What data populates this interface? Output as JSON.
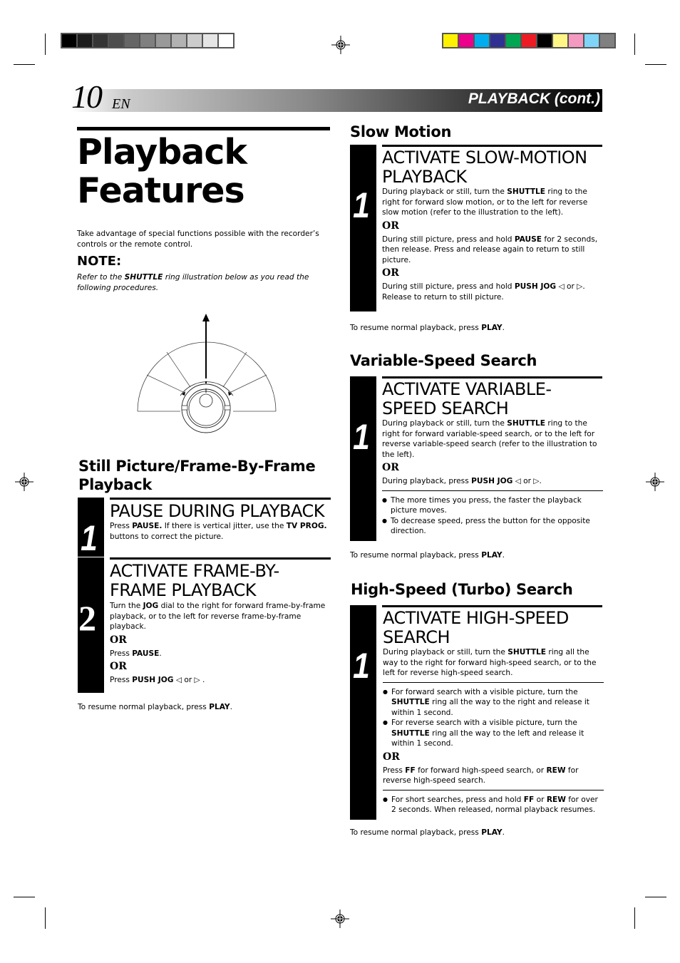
{
  "print_marks": {
    "grayscale_bar": [
      "#000000",
      "#1c1c1c",
      "#353535",
      "#4d4d4d",
      "#666666",
      "#7f7f7f",
      "#999999",
      "#b2b2b2",
      "#cccccc",
      "#e5e5e5",
      "#ffffff"
    ],
    "color_bar": [
      "#fff200",
      "#ec008c",
      "#00aeef",
      "#2e3192",
      "#00a651",
      "#ed1c24",
      "#000000",
      "#fff685",
      "#f49ac1",
      "#7fd4f7",
      "#808080"
    ]
  },
  "header": {
    "page_number": "10",
    "lang": "EN",
    "section_title": "PLAYBACK (cont.)"
  },
  "left": {
    "title_line1": "Playback",
    "title_line2": "Features",
    "intro": "Take advantage of special functions possible with the recorder’s controls or the remote control.",
    "note_heading": "NOTE:",
    "note_pre": "Refer to the ",
    "note_bold": "SHUTTLE",
    "note_post": " ring illustration below as you read the following procedures.",
    "still_heading": "Still Picture/Frame-By-Frame Playback",
    "step1": {
      "number": "1",
      "title": "PAUSE DURING PLAYBACK",
      "t1": "Press ",
      "b1": "PAUSE.",
      "t2": " If there is vertical jitter, use the ",
      "b2": "TV PROG.",
      "t3": " buttons to correct the picture."
    },
    "step2": {
      "number": "2",
      "title": "ACTIVATE FRAME-BY-FRAME PLAYBACK",
      "t1": "Turn the ",
      "b1": "JOG",
      "t2": " dial to the right for forward frame-by-frame playback, or to the left for reverse frame-by-frame playback.",
      "or1": "OR",
      "p2_pre": "Press ",
      "p2_bold": "PAUSE",
      "p2_post": ".",
      "or2": "OR",
      "p3_pre": "Press ",
      "p3_bold": "PUSH JOG",
      "p3_post": " ◁ or ▷ ."
    },
    "resume_pre": "To resume normal playback, press ",
    "resume_bold": "PLAY",
    "resume_post": "."
  },
  "slow": {
    "heading": "Slow Motion",
    "number": "1",
    "title": "ACTIVATE SLOW-MOTION PLAYBACK",
    "p1_a": "During playback or still, turn the ",
    "p1_b": "SHUTTLE",
    "p1_c": " ring to the right for forward slow motion, or to the left for reverse slow motion (refer to the illustration to the left).",
    "or1": "OR",
    "p2_a": "During still picture, press and hold ",
    "p2_b": "PAUSE",
    "p2_c": "  for 2 seconds, then release. Press and release again to return to still picture.",
    "or2": "OR",
    "p3_a": "During still picture, press and hold ",
    "p3_b": "PUSH JOG",
    "p3_c": " ◁ or ▷. Release to return to still picture.",
    "resume_pre": "To resume normal playback, press ",
    "resume_bold": "PLAY",
    "resume_post": "."
  },
  "variable": {
    "heading": "Variable-Speed Search",
    "number": "1",
    "title": "ACTIVATE VARIABLE-SPEED SEARCH",
    "p1_a": "During playback or still, turn the ",
    "p1_b": "SHUTTLE",
    "p1_c": " ring to the right for forward variable-speed search, or to the left for reverse variable-speed search (refer to the illustration to the left).",
    "or1": "OR",
    "p2_a": "During playback, press ",
    "p2_b": "PUSH JOG",
    "p2_c": " ◁ or ▷.",
    "bullets": [
      "The more times you press, the faster the playback picture moves.",
      "To decrease speed, press the button for the opposite direction."
    ],
    "resume_pre": "To resume normal playback, press ",
    "resume_bold": "PLAY",
    "resume_post": "."
  },
  "turbo": {
    "heading": "High-Speed (Turbo) Search",
    "number": "1",
    "title": "ACTIVATE HIGH-SPEED SEARCH",
    "p1_a": "During playback or still, turn the ",
    "p1_b": "SHUTTLE",
    "p1_c": " ring all the way to the right for forward high-speed search, or to the left for reverse high-speed search.",
    "b1_a": "For forward search with a visible picture, turn the ",
    "b1_b": "SHUTTLE",
    "b1_c": " ring all the way to the right and release it within 1 second.",
    "b2_a": "For reverse search with a visible picture, turn the ",
    "b2_b": "SHUTTLE",
    "b2_c": " ring all the way to the left and release it within 1 second.",
    "or1": "OR",
    "p2_a": "Press ",
    "p2_b": "FF",
    "p2_c": " for forward high-speed search, or ",
    "p2_d": "REW",
    "p2_e": " for reverse high-speed search.",
    "b3_a": "For short searches, press and hold ",
    "b3_b": "FF",
    "b3_c": " or ",
    "b3_d": "REW",
    "b3_e": " for over 2 seconds. When released, normal playback resumes.",
    "resume_pre": "To resume normal playback, press ",
    "resume_bold": "PLAY",
    "resume_post": "."
  }
}
